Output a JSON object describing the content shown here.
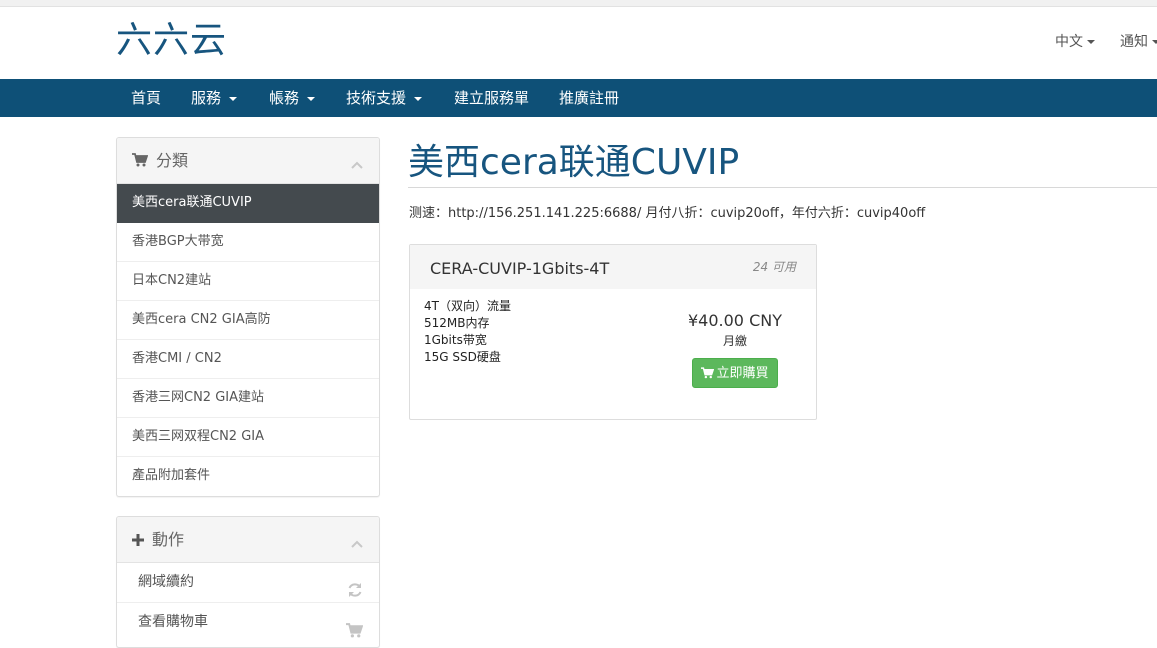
{
  "header": {
    "logo_text": "六六云",
    "language": "中文",
    "notifications": "通知"
  },
  "nav": {
    "items": [
      {
        "label": "首頁",
        "dropdown": false
      },
      {
        "label": "服務",
        "dropdown": true
      },
      {
        "label": "帳務",
        "dropdown": true
      },
      {
        "label": "技術支援",
        "dropdown": true
      },
      {
        "label": "建立服務單",
        "dropdown": false
      },
      {
        "label": "推廣註冊",
        "dropdown": false
      }
    ]
  },
  "sidebar": {
    "categories": {
      "title": "分類",
      "icon": "cart-icon",
      "items": [
        {
          "label": "美西cera联通CUVIP",
          "active": true
        },
        {
          "label": "香港BGP大带宽",
          "active": false
        },
        {
          "label": "日本CN2建站",
          "active": false
        },
        {
          "label": "美西cera CN2 GIA高防",
          "active": false
        },
        {
          "label": "香港CMI / CN2",
          "active": false
        },
        {
          "label": "香港三网CN2 GIA建站",
          "active": false
        },
        {
          "label": "美西三网双程CN2 GIA",
          "active": false
        },
        {
          "label": "產品附加套件",
          "active": false
        }
      ]
    },
    "actions": {
      "title": "動作",
      "icon": "plus-icon",
      "items": [
        {
          "label": "網域續約",
          "icon": "refresh-icon"
        },
        {
          "label": "查看購物車",
          "icon": "cart-icon"
        }
      ]
    }
  },
  "main": {
    "title": "美西cera联通CUVIP",
    "promo": "测速：http://156.251.141.225:6688/ 月付八折：cuvip20off，年付六折：cuvip40off",
    "product": {
      "name": "CERA-CUVIP-1Gbits-4T",
      "qty": "24 可用",
      "features": [
        "4T（双向）流量",
        "512MB内存",
        "1Gbits带宽",
        "15G SSD硬盘"
      ],
      "price": "¥40.00 CNY",
      "cycle": "月繳",
      "buy_label": "立即購買"
    }
  },
  "colors": {
    "brand": "#17557f",
    "navbar": "#0e5077",
    "active_item": "#444a4e",
    "buy_button": "#5cb85c"
  }
}
